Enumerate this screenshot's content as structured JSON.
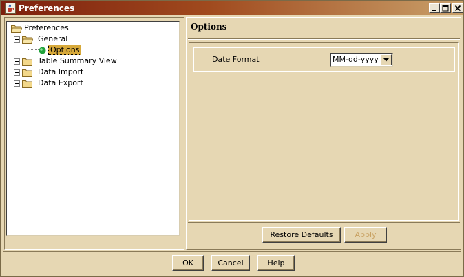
{
  "window": {
    "title": "Preferences",
    "controls": [
      "minimize",
      "maximize",
      "close"
    ]
  },
  "tree": {
    "root": {
      "label": "Preferences",
      "icon": "folder-open-icon"
    },
    "items": [
      {
        "label": "General",
        "expanded": true,
        "icon": "folder-open-icon"
      },
      {
        "label": "Options",
        "selected": true,
        "icon": "green-dot-icon"
      },
      {
        "label": "Table Summary View",
        "expanded": false,
        "icon": "folder-icon"
      },
      {
        "label": "Data Import",
        "expanded": false,
        "icon": "folder-icon"
      },
      {
        "label": "Data Export",
        "expanded": false,
        "icon": "folder-icon"
      }
    ]
  },
  "panel": {
    "title": "Options",
    "date_format_label": "Date Format",
    "date_format_value": "MM-dd-yyyy",
    "restore_defaults": "Restore Defaults",
    "apply": "Apply"
  },
  "footer": {
    "ok": "OK",
    "cancel": "Cancel",
    "help": "Help"
  },
  "colors": {
    "background": "#e6d7b3",
    "titlebar_start": "#7d1f0d",
    "titlebar_end": "#c9a06a",
    "selection": "#d7a93a",
    "disabled_text": "#c8a060",
    "node_green": "#1fa23a"
  }
}
